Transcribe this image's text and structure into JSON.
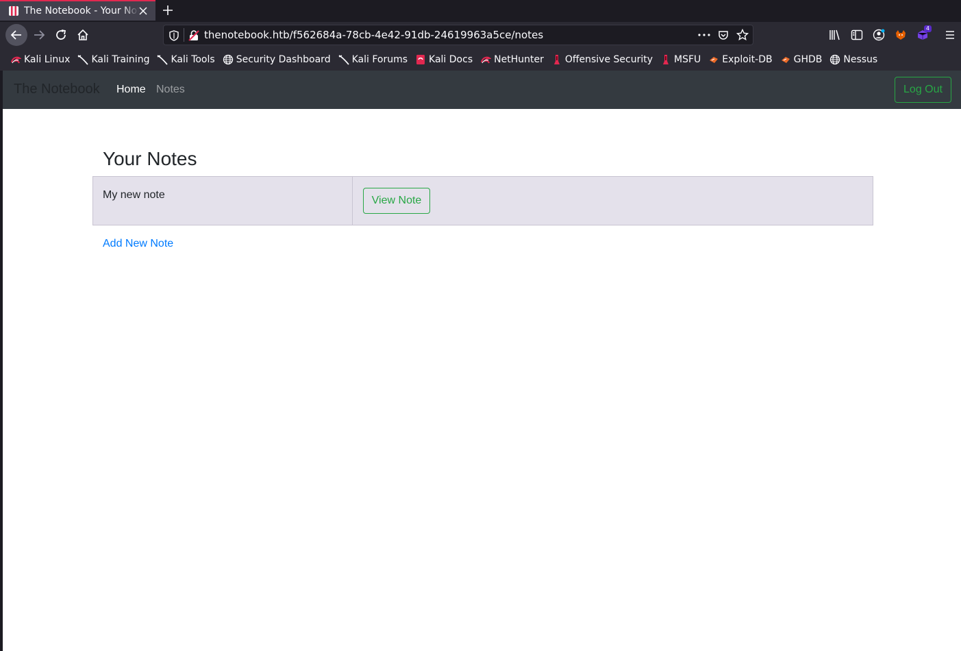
{
  "browser": {
    "tab": {
      "title": "The Notebook - Your Notes",
      "favicon": "notebook-favicon-icon",
      "accent": "#e22850"
    },
    "url": "thenotebook.htb/f562684a-78cb-4e42-91db-24619963a5ce/notes",
    "extension_badge": "4",
    "bookmarks": [
      {
        "label": "Kali Linux",
        "icon": "kali-dragon-icon"
      },
      {
        "label": "Kali Training",
        "icon": "kali-tool-icon"
      },
      {
        "label": "Kali Tools",
        "icon": "kali-tool-icon"
      },
      {
        "label": "Security Dashboard",
        "icon": "globe-icon"
      },
      {
        "label": "Kali Forums",
        "icon": "kali-tool-icon"
      },
      {
        "label": "Kali Docs",
        "icon": "kali-docs-icon"
      },
      {
        "label": "NetHunter",
        "icon": "kali-dragon-icon"
      },
      {
        "label": "Offensive Security",
        "icon": "offsec-icon"
      },
      {
        "label": "MSFU",
        "icon": "offsec-icon"
      },
      {
        "label": "Exploit-DB",
        "icon": "exploitdb-icon"
      },
      {
        "label": "GHDB",
        "icon": "exploitdb-icon"
      },
      {
        "label": "Nessus",
        "icon": "globe-icon"
      }
    ]
  },
  "site": {
    "brand": "The Notebook",
    "nav": {
      "home": "Home",
      "notes": "Notes"
    },
    "logout": "Log Out",
    "heading": "Your Notes",
    "notes": [
      {
        "title": "My new note",
        "action": "View Note"
      }
    ],
    "add_link": "Add New Note",
    "colors": {
      "success": "#28a745",
      "link": "#007bff",
      "navbar": "#343a40",
      "row": "#e4e1eb"
    }
  }
}
